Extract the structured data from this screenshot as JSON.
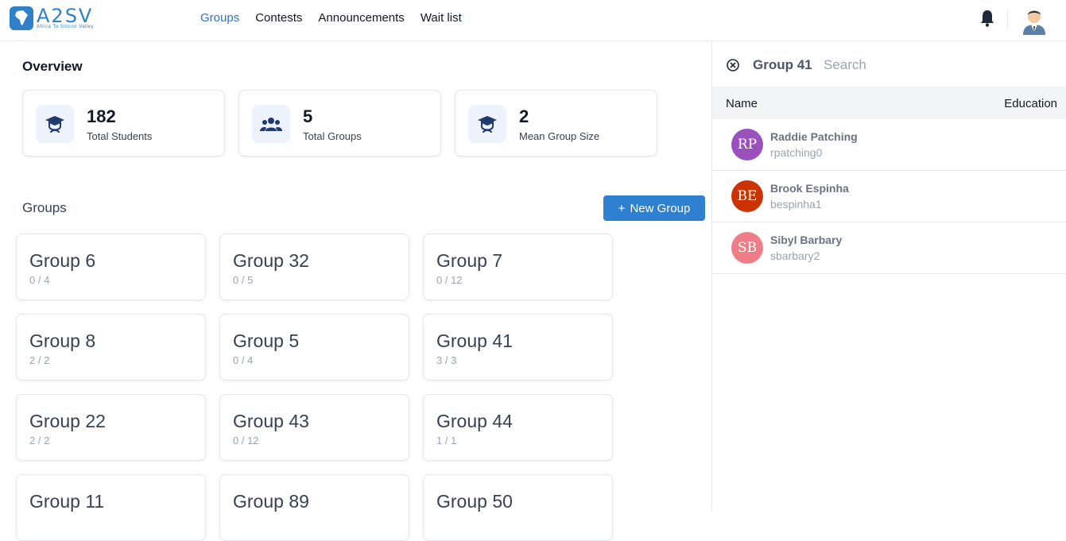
{
  "logo": {
    "text": "A2SV",
    "tagline": "Africa To Silicon Valley"
  },
  "nav": {
    "items": [
      "Groups",
      "Contests",
      "Announcements",
      "Wait list"
    ],
    "active": "Groups"
  },
  "overview": {
    "title": "Overview",
    "stats": [
      {
        "value": "182",
        "label": "Total Students",
        "icon": "graduation-cap-icon"
      },
      {
        "value": "5",
        "label": "Total Groups",
        "icon": "users-icon"
      },
      {
        "value": "2",
        "label": "Mean Group Size",
        "icon": "graduation-cap-icon"
      }
    ]
  },
  "groups": {
    "title": "Groups",
    "new_button": "New Group",
    "new_button_icon": "+",
    "items": [
      {
        "name": "Group 6",
        "count": "0 / 4"
      },
      {
        "name": "Group 32",
        "count": "0 / 5"
      },
      {
        "name": "Group 7",
        "count": "0 / 12"
      },
      {
        "name": "Group 8",
        "count": "2 / 2"
      },
      {
        "name": "Group 5",
        "count": "0 / 4"
      },
      {
        "name": "Group 41",
        "count": "3 / 3"
      },
      {
        "name": "Group 22",
        "count": "2 / 2"
      },
      {
        "name": "Group 43",
        "count": "0 / 12"
      },
      {
        "name": "Group 44",
        "count": "1 / 1"
      },
      {
        "name": "Group 11",
        "count": ""
      },
      {
        "name": "Group 89",
        "count": ""
      },
      {
        "name": "Group 50",
        "count": ""
      }
    ]
  },
  "panel": {
    "title": "Group 41",
    "search_placeholder": "Search",
    "columns": {
      "name": "Name",
      "education": "Education"
    },
    "members": [
      {
        "initials": "RP",
        "name": "Raddie Patching",
        "username": "rpatching0",
        "color": "#9b51bd"
      },
      {
        "initials": "BE",
        "name": "Brook Espinha",
        "username": "bespinha1",
        "color": "#cc3300"
      },
      {
        "initials": "SB",
        "name": "Sibyl Barbary",
        "username": "sbarbary2",
        "color": "#ef7d88"
      }
    ]
  },
  "colors": {
    "accent": "#2f80d0",
    "nav_active": "#2f6fd1"
  }
}
